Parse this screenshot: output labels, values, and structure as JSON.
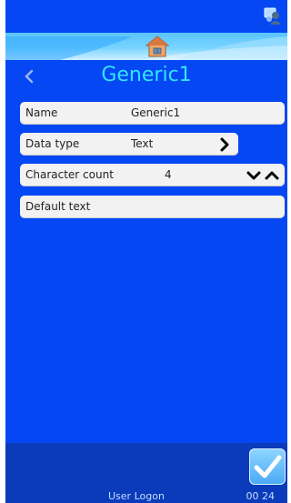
{
  "header": {
    "title": "Generic1",
    "back_icon": "chevron-left-icon",
    "home_icon": "home-icon",
    "status_icon": "user-network-icon"
  },
  "fields": {
    "name": {
      "label": "Name",
      "value": "Generic1"
    },
    "data_type": {
      "label": "Data type",
      "value": "Text",
      "action_icon": "chevron-right-icon"
    },
    "character_count": {
      "label": "Character count",
      "value": "4",
      "decrease_icon": "chevron-down-icon",
      "increase_icon": "chevron-up-icon"
    },
    "default_text": {
      "label": "Default text",
      "value": ""
    }
  },
  "footer": {
    "user_label": "User Logon",
    "time": "00 24",
    "confirm_icon": "check-icon"
  },
  "colors": {
    "background": "#0447f3",
    "title": "#35e3ff",
    "row": "#f2f2f2",
    "bottom_bar": "#0b3bbb"
  }
}
